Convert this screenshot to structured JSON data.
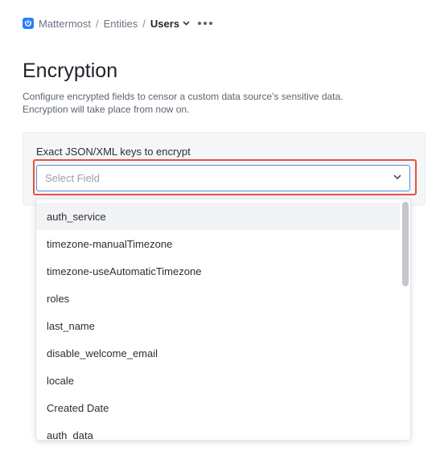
{
  "breadcrumb": {
    "items": [
      "Mattermost",
      "Entities"
    ],
    "current": "Users",
    "separator": "/"
  },
  "page": {
    "title": "Encryption",
    "description_line1": "Configure encrypted fields to censor a custom data source's sensitive data.",
    "description_line2": "Encryption will take place from now on."
  },
  "form": {
    "label": "Exact JSON/XML keys to encrypt",
    "placeholder": "Select Field"
  },
  "dropdown": {
    "options": [
      "auth_service",
      "timezone-manualTimezone",
      "timezone-useAutomaticTimezone",
      "roles",
      "last_name",
      "disable_welcome_email",
      "locale",
      "Created Date",
      "auth_data"
    ],
    "highlighted_index": 0
  },
  "colors": {
    "accent": "#2d7ff9",
    "highlight_border": "#e5533d",
    "focus_border": "#4a90e2"
  }
}
